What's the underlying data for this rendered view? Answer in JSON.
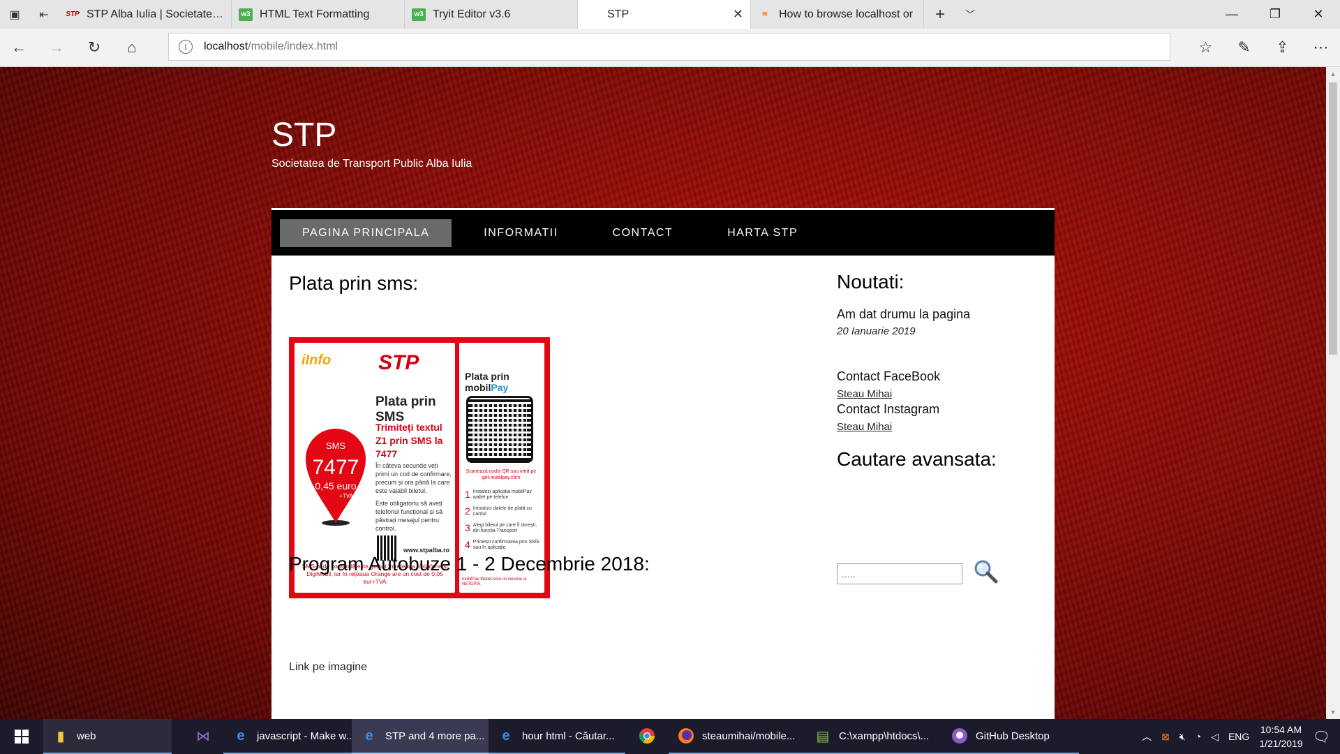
{
  "browser": {
    "tabs": [
      {
        "title": "STP Alba Iulia | Societatea d",
        "favicon": "stp"
      },
      {
        "title": "HTML Text Formatting",
        "favicon": "w3"
      },
      {
        "title": "Tryit Editor v3.6",
        "favicon": "w3"
      },
      {
        "title": "STP",
        "favicon": "none",
        "active": true
      },
      {
        "title": "How to browse localhost or",
        "favicon": "stackoverflow"
      }
    ],
    "address": {
      "host": "localhost",
      "path": "/mobile/index.html"
    }
  },
  "site": {
    "title": "STP",
    "subtitle": "Societatea de Transport Public Alba Iulia",
    "menu": [
      {
        "label": "PAGINA PRINCIPALA",
        "current": true
      },
      {
        "label": "INFORMATII"
      },
      {
        "label": "CONTACT"
      },
      {
        "label": "HARTA STP"
      }
    ],
    "main": {
      "heading1": "Plata prin sms:",
      "heading2": "Program Autobuze 1 - 2 Decembrie 2018:",
      "link_text": "Link pe imagine"
    },
    "poster": {
      "info_logo": "iInfo",
      "stp_logo": "STP",
      "title": "Plata prin SMS",
      "red_text": "Trimiteți textul Z1 prin SMS la 7477",
      "pin_top": "SMS",
      "pin_number": "7477",
      "pin_price": "0,45 euro",
      "pin_tva": "+TVA",
      "small_text": "În câteva secunde veți primi un cod de confirmare, precum și ora până la care este valabil biletul.",
      "small_text2": "Este obligatoriu să aveți telefonul funcțional și să păstrați mesajul pentru control.",
      "url": "www.stpalba.ro",
      "footer": "SMS-ul de comandă este gratuit în rețeaua Vodafone și DigiMobil, iar în rețeaua Orange are un cost de 0,05 eur+TVA",
      "right_title_a": "Plata prin mobil",
      "right_title_b": "Pay",
      "right_caption": "Scanează codul QR sau intră pe get.mobilpay.com",
      "steps": [
        {
          "n": "1",
          "text": "Instalezi aplicația mobilPay wallet pe telefon"
        },
        {
          "n": "2",
          "text": "Introduci datele de plată cu cardul"
        },
        {
          "n": "3",
          "text": "Alegi biletul pe care îl dorești, din funcția Transport"
        },
        {
          "n": "4",
          "text": "Primești confirmarea prin SMS sau în aplicație"
        }
      ],
      "right_footer": "mobilPay Wallet este un serviciu al NETOPIA."
    },
    "sidebar": {
      "heading": "Noutati:",
      "news_title": "Am dat drumu la pagina",
      "news_date": "20 Ianuarie 2019",
      "facebook_label": "Contact FaceBook",
      "facebook_link": "Steau Mihai",
      "instagram_label": "Contact Instagram",
      "instagram_link": "Steau Mihai",
      "search_heading": "Cautare avansata:",
      "search_placeholder": "....."
    }
  },
  "taskbar": {
    "items": [
      {
        "label": "web",
        "icon": "folder-icon"
      },
      {
        "label": "",
        "icon": "visual-studio-icon"
      },
      {
        "label": "javascript - Make w...",
        "icon": "edge-icon"
      },
      {
        "label": "STP and 4 more pa...",
        "icon": "edge-icon",
        "active": true
      },
      {
        "label": "hour html - Căutar...",
        "icon": "edge-icon"
      },
      {
        "label": "",
        "icon": "chrome-icon"
      },
      {
        "label": "steaumihai/mobile...",
        "icon": "firefox-icon"
      },
      {
        "label": "C:\\xampp\\htdocs\\...",
        "icon": "notepad-icon"
      },
      {
        "label": "GitHub Desktop",
        "icon": "github-icon"
      }
    ],
    "language": "ENG",
    "time": "10:54 AM",
    "date": "1/21/2019"
  },
  "colors": {
    "menu_bg": "#000000",
    "menu_current": "#6a6a6a",
    "poster_red": "#e30613",
    "page_bg": "#8e0d06"
  }
}
